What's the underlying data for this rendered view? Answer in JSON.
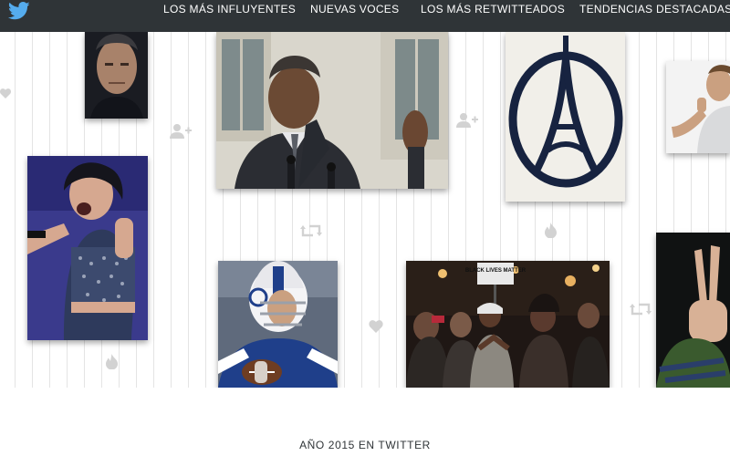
{
  "brand": {
    "logo_icon": "twitter-bird-icon",
    "color": "#55acee"
  },
  "nav": {
    "items": [
      {
        "label": "LOS MÁS INFLUYENTES"
      },
      {
        "label": "NUEVAS VOCES"
      },
      {
        "label": "LOS MÁS RETWITTEADOS"
      },
      {
        "label": "TENDENCIAS DESTACADAS"
      }
    ]
  },
  "collage": {
    "photos": [
      {
        "subject": "elderly man portrait"
      },
      {
        "subject": "president at podium"
      },
      {
        "subject": "eiffel tower peace symbol drawing"
      },
      {
        "subject": "man giving thumbs up"
      },
      {
        "subject": "singer performing with microphone"
      },
      {
        "subject": "football quarterback in helmet"
      },
      {
        "subject": "protest crowd at night",
        "sign_text": "BLACK LIVES MATTER"
      },
      {
        "subject": "hand making peace sign"
      }
    ],
    "icons": [
      "heart-icon",
      "follow-icon",
      "retweet-icon",
      "flame-icon"
    ]
  },
  "footer": {
    "title": "AÑO 2015 EN TWITTER"
  }
}
